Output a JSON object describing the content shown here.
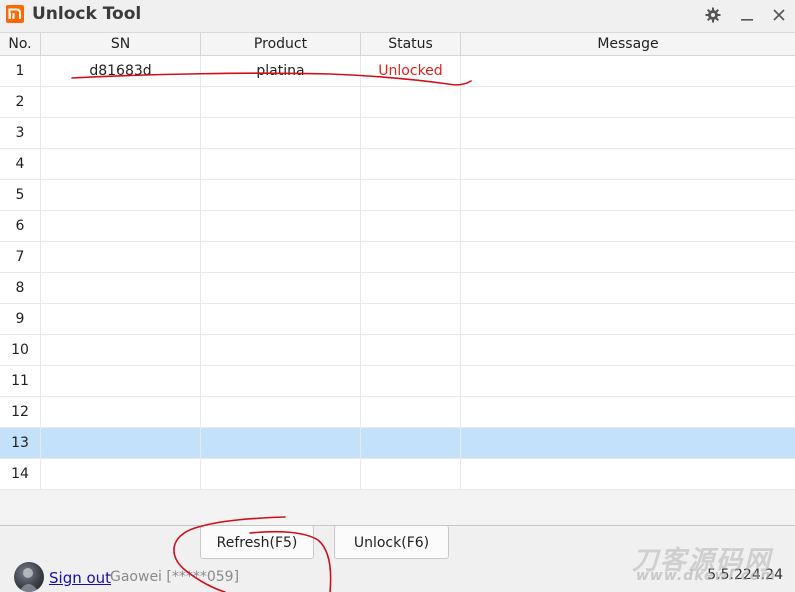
{
  "window": {
    "title": "Unlock Tool"
  },
  "icons": {
    "logo": "mi-logo",
    "settings": "gear-icon",
    "minimize": "minimize-icon",
    "close": "close-icon"
  },
  "table": {
    "columns": [
      "No.",
      "SN",
      "Product",
      "Status",
      "Message"
    ],
    "rows": [
      {
        "no": "1",
        "sn": "d81683d",
        "product": "platina",
        "status": "Unlocked",
        "message": ""
      },
      {
        "no": "2",
        "sn": "",
        "product": "",
        "status": "",
        "message": ""
      },
      {
        "no": "3",
        "sn": "",
        "product": "",
        "status": "",
        "message": ""
      },
      {
        "no": "4",
        "sn": "",
        "product": "",
        "status": "",
        "message": ""
      },
      {
        "no": "5",
        "sn": "",
        "product": "",
        "status": "",
        "message": ""
      },
      {
        "no": "6",
        "sn": "",
        "product": "",
        "status": "",
        "message": ""
      },
      {
        "no": "7",
        "sn": "",
        "product": "",
        "status": "",
        "message": ""
      },
      {
        "no": "8",
        "sn": "",
        "product": "",
        "status": "",
        "message": ""
      },
      {
        "no": "9",
        "sn": "",
        "product": "",
        "status": "",
        "message": ""
      },
      {
        "no": "10",
        "sn": "",
        "product": "",
        "status": "",
        "message": ""
      },
      {
        "no": "11",
        "sn": "",
        "product": "",
        "status": "",
        "message": ""
      },
      {
        "no": "12",
        "sn": "",
        "product": "",
        "status": "",
        "message": ""
      },
      {
        "no": "13",
        "sn": "",
        "product": "",
        "status": "",
        "message": ""
      },
      {
        "no": "14",
        "sn": "",
        "product": "",
        "status": "",
        "message": ""
      }
    ],
    "selected_row": 13
  },
  "buttons": {
    "refresh": "Refresh(F5)",
    "unlock": "Unlock(F6)"
  },
  "footer": {
    "sign_out": "Sign out",
    "user": "Gaowei [*****059]",
    "version": "5.5.224.24"
  },
  "watermark": {
    "main": "刀客源码网",
    "sub": "www.dkewl.com"
  },
  "colors": {
    "accent": "#ff6700",
    "status_unlocked": "#e2231a",
    "selected_row": "#c3e1fb",
    "annotation": "#d0101a"
  }
}
